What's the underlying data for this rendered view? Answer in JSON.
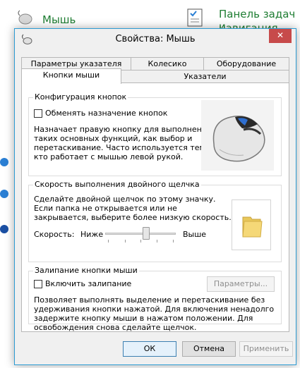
{
  "background": {
    "items": [
      {
        "label": "Мышь"
      },
      {
        "label": "Панель задач и"
      },
      {
        "label": "навигация"
      }
    ]
  },
  "window": {
    "title": "Свойства: Мышь",
    "close_glyph": "✕"
  },
  "tabs": [
    {
      "label": "Параметры указателя"
    },
    {
      "label": "Колесико"
    },
    {
      "label": "Оборудование"
    },
    {
      "label": "Кнопки мыши",
      "active": true
    },
    {
      "label": "Указатели"
    }
  ],
  "buttons_config": {
    "title": "Конфигурация кнопок",
    "checkbox_label": "Обменять назначение кнопок",
    "checked": false,
    "description": [
      "Назначает правую кнопку для выполнения",
      "таких основных функций, как выбор и",
      "перетаскивание. Часто используется теми,",
      "кто работает с мышью левой рукой."
    ]
  },
  "double_click": {
    "title": "Скорость выполнения двойного щелчка",
    "description": [
      "Сделайте двойной щелчок по этому значку.",
      "Если папка не открывается или не",
      "закрывается, выберите более низкую скорость."
    ],
    "speed_label": "Скорость:",
    "low_label": "Ниже",
    "high_label": "Выше",
    "speed_fraction": 0.58
  },
  "click_lock": {
    "title": "Залипание кнопки мыши",
    "checkbox_label": "Включить залипание",
    "checked": false,
    "settings_button": "Параметры...",
    "description": [
      "Позволяет выполнять выделение и перетаскивание без",
      "удерживания кнопки нажатой. Для включения ненадолго",
      "задержите кнопку мыши в нажатом положении. Для",
      "освобождения снова сделайте щелчок."
    ]
  },
  "footer": {
    "ok": "ОК",
    "cancel": "Отмена",
    "apply": "Применить"
  },
  "colors": {
    "link_green": "#1e7d32",
    "close_red": "#c74a4a",
    "window_border": "#2c9bd3"
  }
}
